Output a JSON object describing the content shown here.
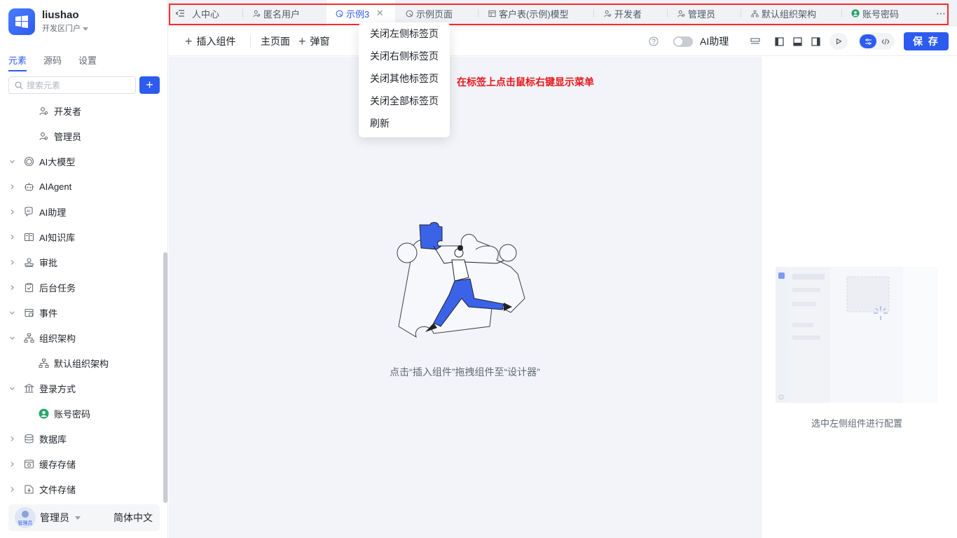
{
  "app": {
    "name": "liushao",
    "portal": "开发区门户"
  },
  "sidebar": {
    "tabs": [
      {
        "label": "元素"
      },
      {
        "label": "源码"
      },
      {
        "label": "设置"
      }
    ],
    "search_placeholder": "搜索元素",
    "add_label": "+",
    "items": [
      {
        "label": "开发者",
        "icon": "user-role-icon"
      },
      {
        "label": "管理员",
        "icon": "user-role-icon"
      },
      {
        "label": "AI大模型",
        "icon": "ai-model-icon"
      },
      {
        "label": "AIAgent",
        "icon": "robot-icon"
      },
      {
        "label": "AI助理",
        "icon": "ai-assistant-icon"
      },
      {
        "label": "AI知识库",
        "icon": "book-icon"
      },
      {
        "label": "审批",
        "icon": "stamp-icon"
      },
      {
        "label": "后台任务",
        "icon": "clipboard-icon"
      },
      {
        "label": "事件",
        "icon": "event-icon"
      },
      {
        "label": "组织架构",
        "icon": "org-chart-icon"
      },
      {
        "label": "默认组织架构",
        "icon": "org-chart-icon"
      },
      {
        "label": "登录方式",
        "icon": "bank-icon"
      },
      {
        "label": "账号密码",
        "icon": "account-icon"
      },
      {
        "label": "数据库",
        "icon": "database-icon"
      },
      {
        "label": "缓存存储",
        "icon": "cache-icon"
      },
      {
        "label": "文件存储",
        "icon": "file-store-icon"
      }
    ],
    "user": {
      "name": "管理员",
      "avatar_text": "管理员"
    },
    "language": "简体中文"
  },
  "tabs": [
    {
      "label": "人中心"
    },
    {
      "label": "匿名用户"
    },
    {
      "label": "示例3"
    },
    {
      "label": "示例页面"
    },
    {
      "label": "客户表(示例)模型"
    },
    {
      "label": "开发者"
    },
    {
      "label": "管理员"
    },
    {
      "label": "默认组织架构"
    },
    {
      "label": "账号密码"
    }
  ],
  "toolbar": {
    "insert": "插入组件",
    "main_page": "主页面",
    "popup": "弹窗",
    "ai_assistant": "AI助理",
    "save": "保 存"
  },
  "context_menu": [
    {
      "label": "关闭左侧标签页"
    },
    {
      "label": "关闭右侧标签页"
    },
    {
      "label": "关闭其他标签页"
    },
    {
      "label": "关闭全部标签页"
    },
    {
      "label": "刷新"
    }
  ],
  "annotation": "在标签上点击鼠标右键显示菜单",
  "canvas": {
    "hint": "点击“插入组件”拖拽组件至“设计器”"
  },
  "right_panel": {
    "hint": "选中左侧组件进行配置"
  },
  "colors": {
    "accent": "#2d5bf0",
    "annotation": "#e8171c",
    "canvas_bg": "#f2f4f9"
  }
}
